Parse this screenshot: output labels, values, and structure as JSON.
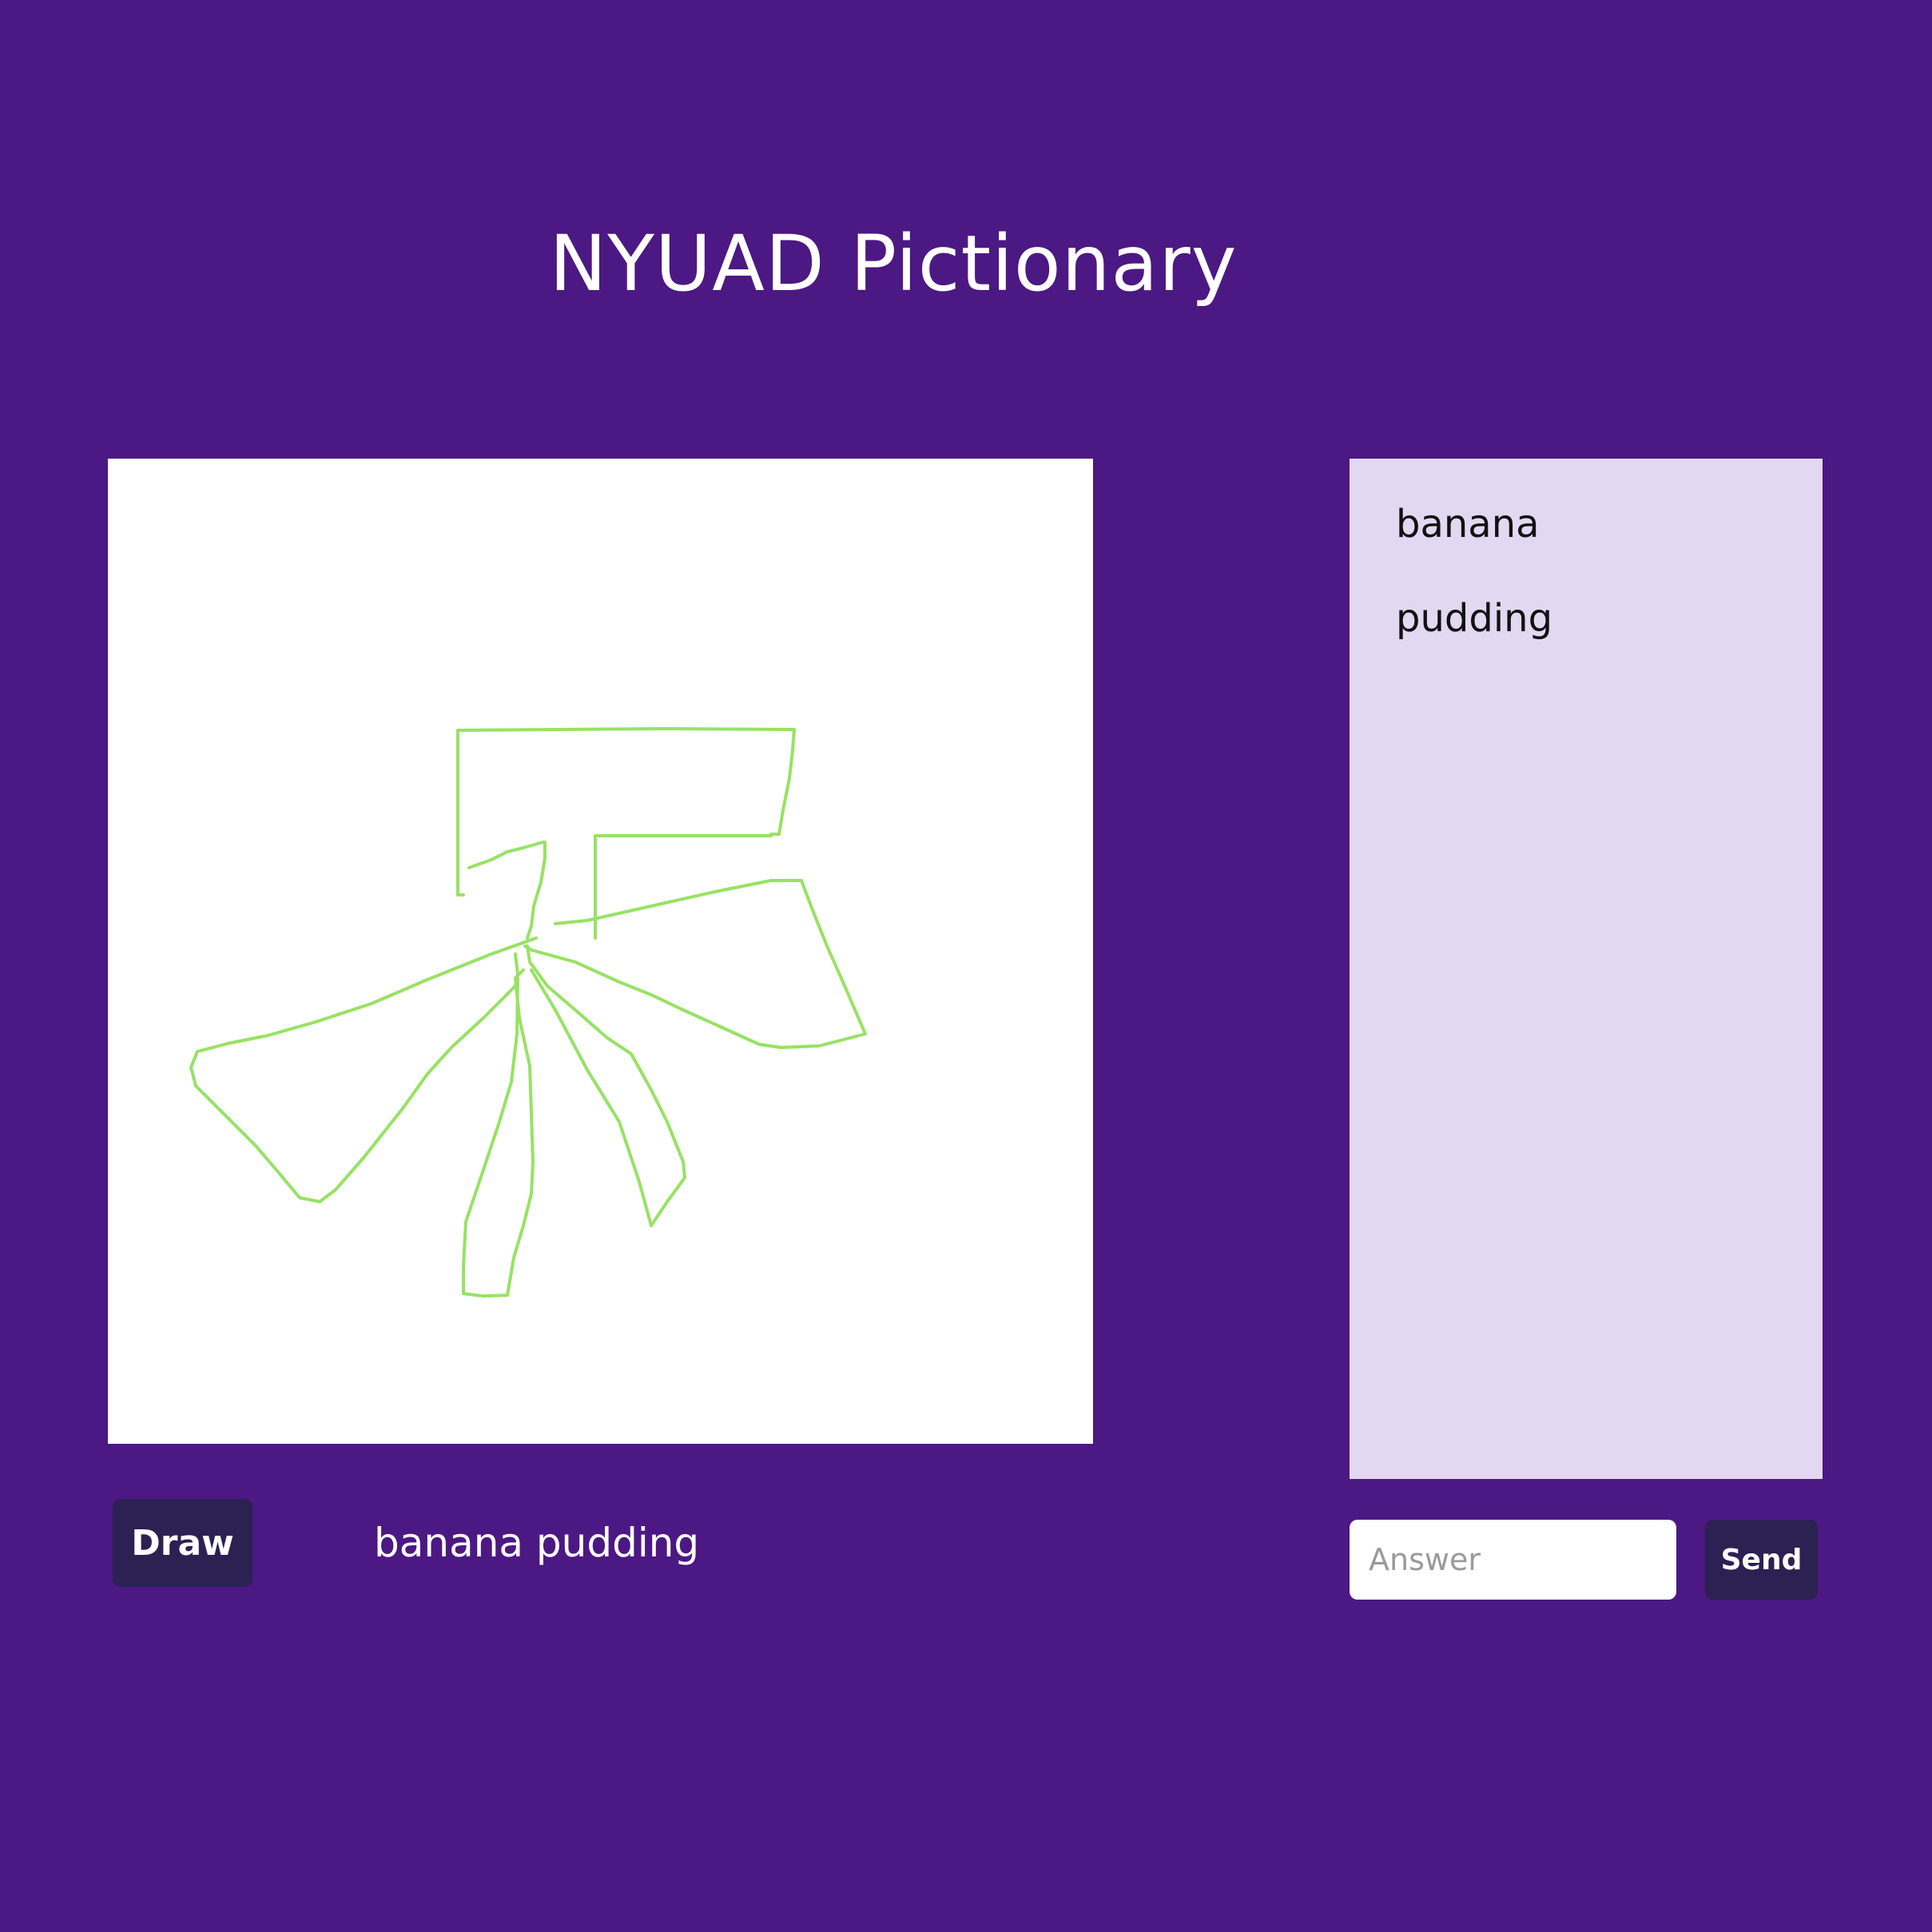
{
  "app": {
    "title": "NYUAD Pictionary"
  },
  "canvas": {
    "background": "#ffffff",
    "stroke_color": "#97e263"
  },
  "controls": {
    "draw_label": "Draw",
    "current_word": "banana pudding"
  },
  "guesses": {
    "items": [
      "banana",
      "pudding"
    ]
  },
  "answer": {
    "placeholder": "Answer",
    "value": "",
    "send_label": "Send"
  },
  "colors": {
    "background": "#4c1883",
    "button": "#2b2152",
    "panel": "#e3d8f2"
  }
}
